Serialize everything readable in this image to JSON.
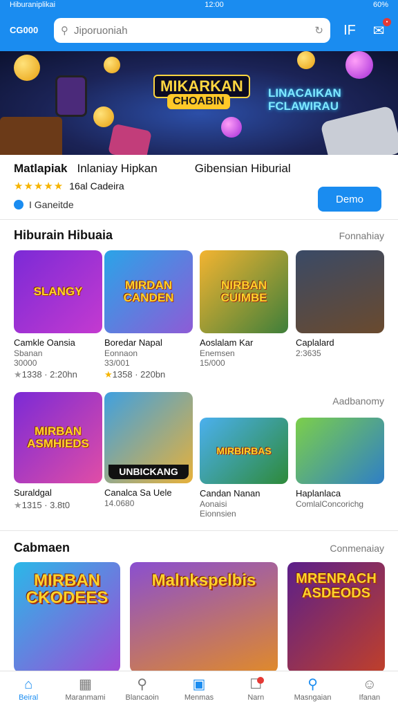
{
  "status_bar": {
    "carrier": "Hiburaniplikai",
    "time": "12:00",
    "battery": "60%"
  },
  "header": {
    "logo": "CG000",
    "search_placeholder": "Jiporuoniah",
    "icon_label": "IF"
  },
  "banner": {
    "title": "MIKARKAN",
    "subtitle": "CHOABIN",
    "neon_text": "LINACAIKAN FCLAWIRAU"
  },
  "featured": {
    "app_name": "Matlapiak",
    "tagline": "Inlaniay Hipkan",
    "category": "Gibensian Hiburial",
    "stars": "★★★★★",
    "rating_text": "16al Cadeira",
    "badge_text": "I Ganeitde",
    "action_label": "Demo"
  },
  "section1": {
    "title": "Hiburain Hibuaia",
    "more": "Fonnahiay",
    "more2": "Aadbanomy",
    "cards": [
      {
        "thumb": "SLANGY",
        "title": "Camkle Oansia",
        "sub": "Sbanan",
        "sub2": "30000",
        "rating": "1338 · 2:20hn",
        "star_color": "gray"
      },
      {
        "thumb": "MIRDAN CANDEN",
        "title": "Boredar Napal",
        "sub": "Eonnaon",
        "sub2": "33/001",
        "rating": "1358 · 220bn",
        "star_color": "gold"
      },
      {
        "thumb": "NIRBAN CUIMBE",
        "title": "Aoslalam Kar",
        "sub": "Enemsen",
        "sub2": "15/000",
        "rating": "",
        "star_color": "gray"
      },
      {
        "thumb": "",
        "title": "Caplalard",
        "sub": "2:3635",
        "sub2": "",
        "rating": "",
        "star_color": "gray"
      },
      {
        "thumb": "MIRBAN ASMHIEDS",
        "title": "Suraldgal",
        "sub": "",
        "sub2": "",
        "rating": "1315 · 3.8t0",
        "star_color": "gray"
      },
      {
        "thumb": "UNBICKANG",
        "title": "Canalca Sa Uele",
        "sub": "14.0680",
        "sub2": "",
        "rating": "",
        "star_color": "gray"
      },
      {
        "thumb": "MIRBIRBAS",
        "title": "Candan Nanan",
        "sub": "Aonaisi",
        "sub2": "Eionnsien",
        "rating": "",
        "star_color": "gray"
      },
      {
        "thumb": "",
        "title": "Haplanlaca",
        "sub": "ComlalConcorichg",
        "sub2": "",
        "rating": "",
        "star_color": "gray"
      }
    ]
  },
  "section2": {
    "title": "Cabmaen",
    "more": "Conmenaiay",
    "cards": [
      {
        "thumb": "MIRBAN CKODEES"
      },
      {
        "thumb": "Malnkspelbis"
      },
      {
        "thumb": "MRENRACH ASDEODS"
      }
    ]
  },
  "bottom_nav": [
    {
      "label": "Beiral",
      "icon": "home-icon"
    },
    {
      "label": "Maranmami",
      "icon": "building-icon"
    },
    {
      "label": "Blancaoin",
      "icon": "search-icon"
    },
    {
      "label": "Menmas",
      "icon": "calendar-icon"
    },
    {
      "label": "Narn",
      "icon": "bell-icon"
    },
    {
      "label": "Masngaian",
      "icon": "search-circle-icon"
    },
    {
      "label": "Ifanan",
      "icon": "person-icon"
    }
  ],
  "colors": {
    "primary": "#1a8cf0",
    "star": "#f6b400"
  }
}
